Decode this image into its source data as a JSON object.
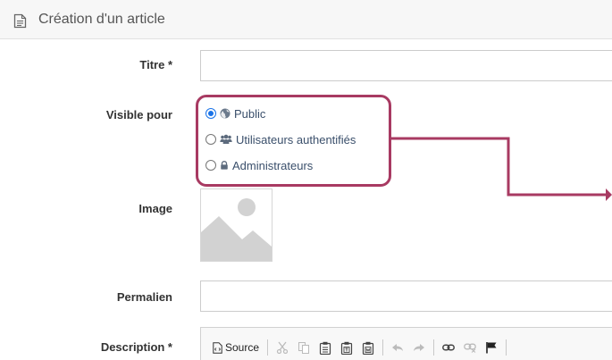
{
  "header": {
    "title": "Création d'un article",
    "icon": "document-icon"
  },
  "form": {
    "title_label": "Titre *",
    "title_value": "",
    "visibility_label": "Visible pour",
    "visibility_options": [
      {
        "label": "Public",
        "icon": "globe-icon",
        "checked": true
      },
      {
        "label": "Utilisateurs authentifiés",
        "icon": "users-icon",
        "checked": false
      },
      {
        "label": "Administrateurs",
        "icon": "lock-icon",
        "checked": false
      }
    ],
    "image_label": "Image",
    "permalink_label": "Permalien",
    "permalink_value": "",
    "description_label": "Description *"
  },
  "editor_toolbar": {
    "source_label": "Source",
    "buttons": [
      "source-icon",
      "cut-icon",
      "copy-icon",
      "paste-icon",
      "paste-text-icon",
      "paste-word-icon",
      "undo-icon",
      "redo-icon",
      "link-icon",
      "unlink-icon",
      "anchor-flag-icon"
    ]
  },
  "colors": {
    "highlight": "#a83a62",
    "radio_checked": "#1a73e8",
    "option_text": "#3a4f6b"
  }
}
